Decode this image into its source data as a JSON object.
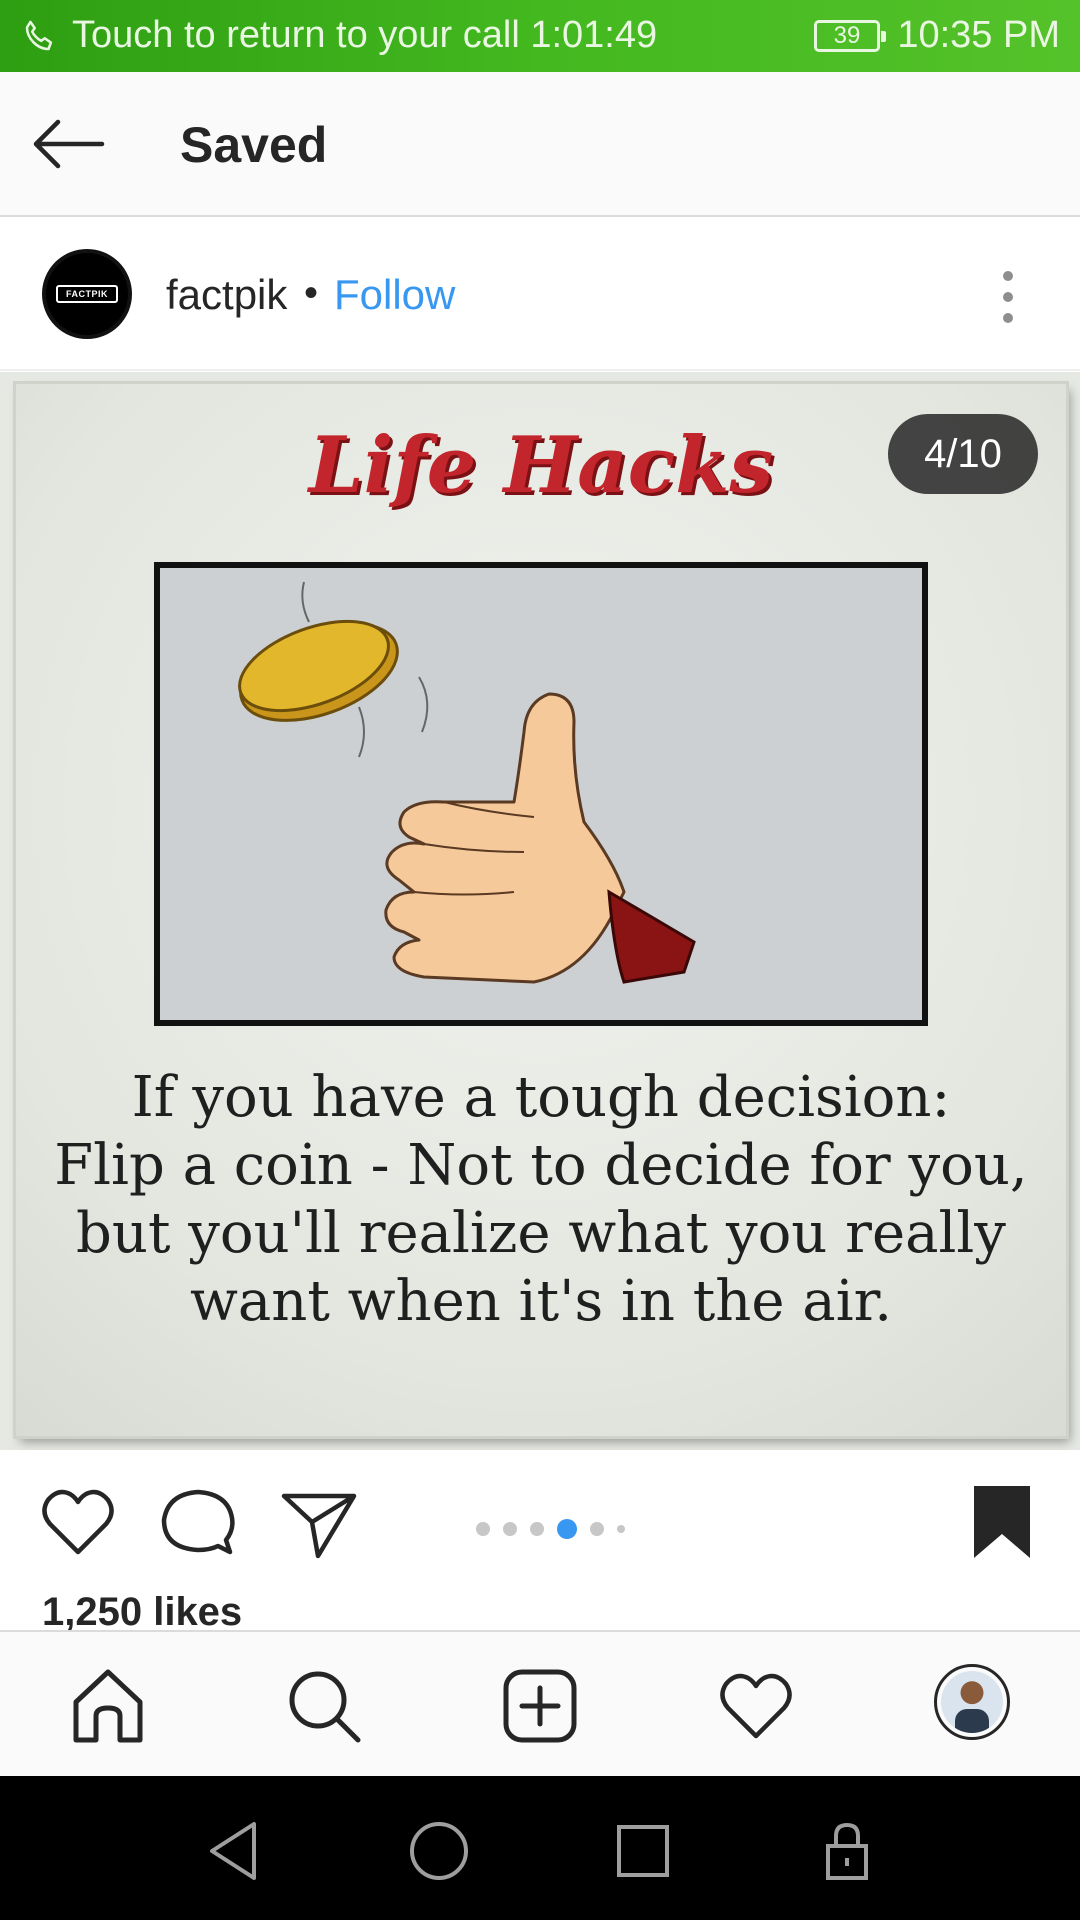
{
  "status_bar": {
    "call_text": "Touch to return to your call 1:01:49",
    "battery": "39",
    "time": "10:35 PM"
  },
  "header": {
    "title": "Saved"
  },
  "post": {
    "username": "factpik",
    "separator": "•",
    "follow_label": "Follow",
    "avatar_logo_text": "FACTPIK",
    "image": {
      "title": "Life Hacks",
      "page_indicator": "4/10",
      "caption_lines": [
        "If you have a tough decision:",
        "Flip a coin - Not to decide for you,",
        "but you'll realize what you really",
        "want when it's in the air."
      ]
    },
    "carousel": {
      "total_visible_dots": 6,
      "active_index": 3
    },
    "likes": "1,250 likes"
  },
  "icons": {
    "status": [
      "phone-icon",
      "battery-icon"
    ],
    "header": [
      "back-arrow-icon"
    ],
    "actions": [
      "heart-icon",
      "comment-icon",
      "share-icon",
      "bookmark-icon"
    ],
    "nav": [
      "home-icon",
      "search-icon",
      "add-post-icon",
      "activity-heart-icon",
      "profile-avatar"
    ],
    "system": [
      "back-triangle-icon",
      "home-circle-icon",
      "recents-square-icon",
      "lock-icon"
    ]
  },
  "colors": {
    "status_bar": "#43b81f",
    "follow": "#3897f0",
    "active_dot": "#3897f0",
    "title_red": "#c3252c"
  }
}
